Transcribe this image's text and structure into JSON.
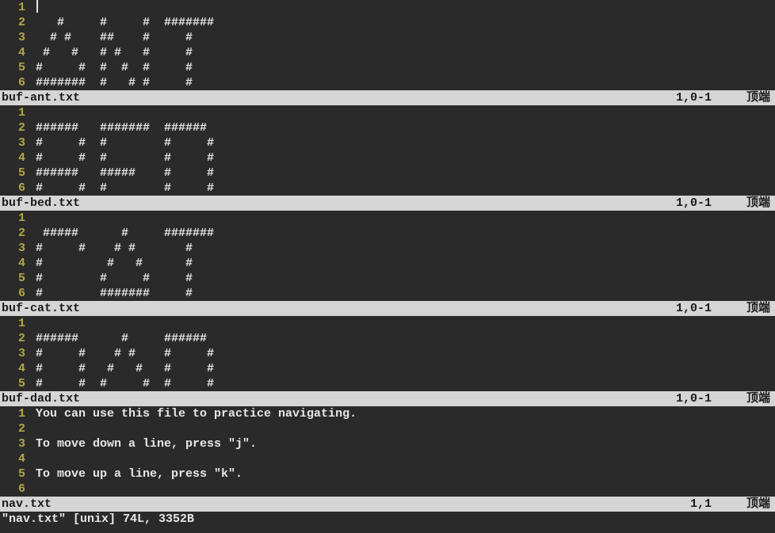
{
  "buffers": [
    {
      "filename": "buf-ant.txt",
      "position": "1,0-1",
      "indicator": "顶端",
      "lines": [
        "",
        "   #     #     #  #######",
        "  # #    ##    #     #",
        " #   #   # #   #     #",
        "#     #  #  #  #     #",
        "#######  #   # #     #"
      ]
    },
    {
      "filename": "buf-bed.txt",
      "position": "1,0-1",
      "indicator": "顶端",
      "lines": [
        "",
        "######   #######  ######",
        "#     #  #        #     #",
        "#     #  #        #     #",
        "######   #####    #     #",
        "#     #  #        #     #"
      ]
    },
    {
      "filename": "buf-cat.txt",
      "position": "1,0-1",
      "indicator": "顶端",
      "lines": [
        "",
        " #####      #     #######",
        "#     #    # #       #",
        "#         #   #      #",
        "#        #     #     #",
        "#        #######     #"
      ]
    },
    {
      "filename": "buf-dad.txt",
      "position": "1,0-1",
      "indicator": "顶端",
      "lines": [
        "",
        "######      #     ######",
        "#     #    # #    #     #",
        "#     #   #   #   #     #",
        "#     #  #     #  #     #"
      ]
    },
    {
      "filename": "nav.txt",
      "position": "1,1",
      "indicator": "顶端",
      "lines": [
        "You can use this file to practice navigating.",
        "",
        "To move down a line, press \"j\".",
        "",
        "To move up a line, press \"k\".",
        ""
      ]
    }
  ],
  "command_line": "\"nav.txt\" [unix] 74L, 3352B"
}
